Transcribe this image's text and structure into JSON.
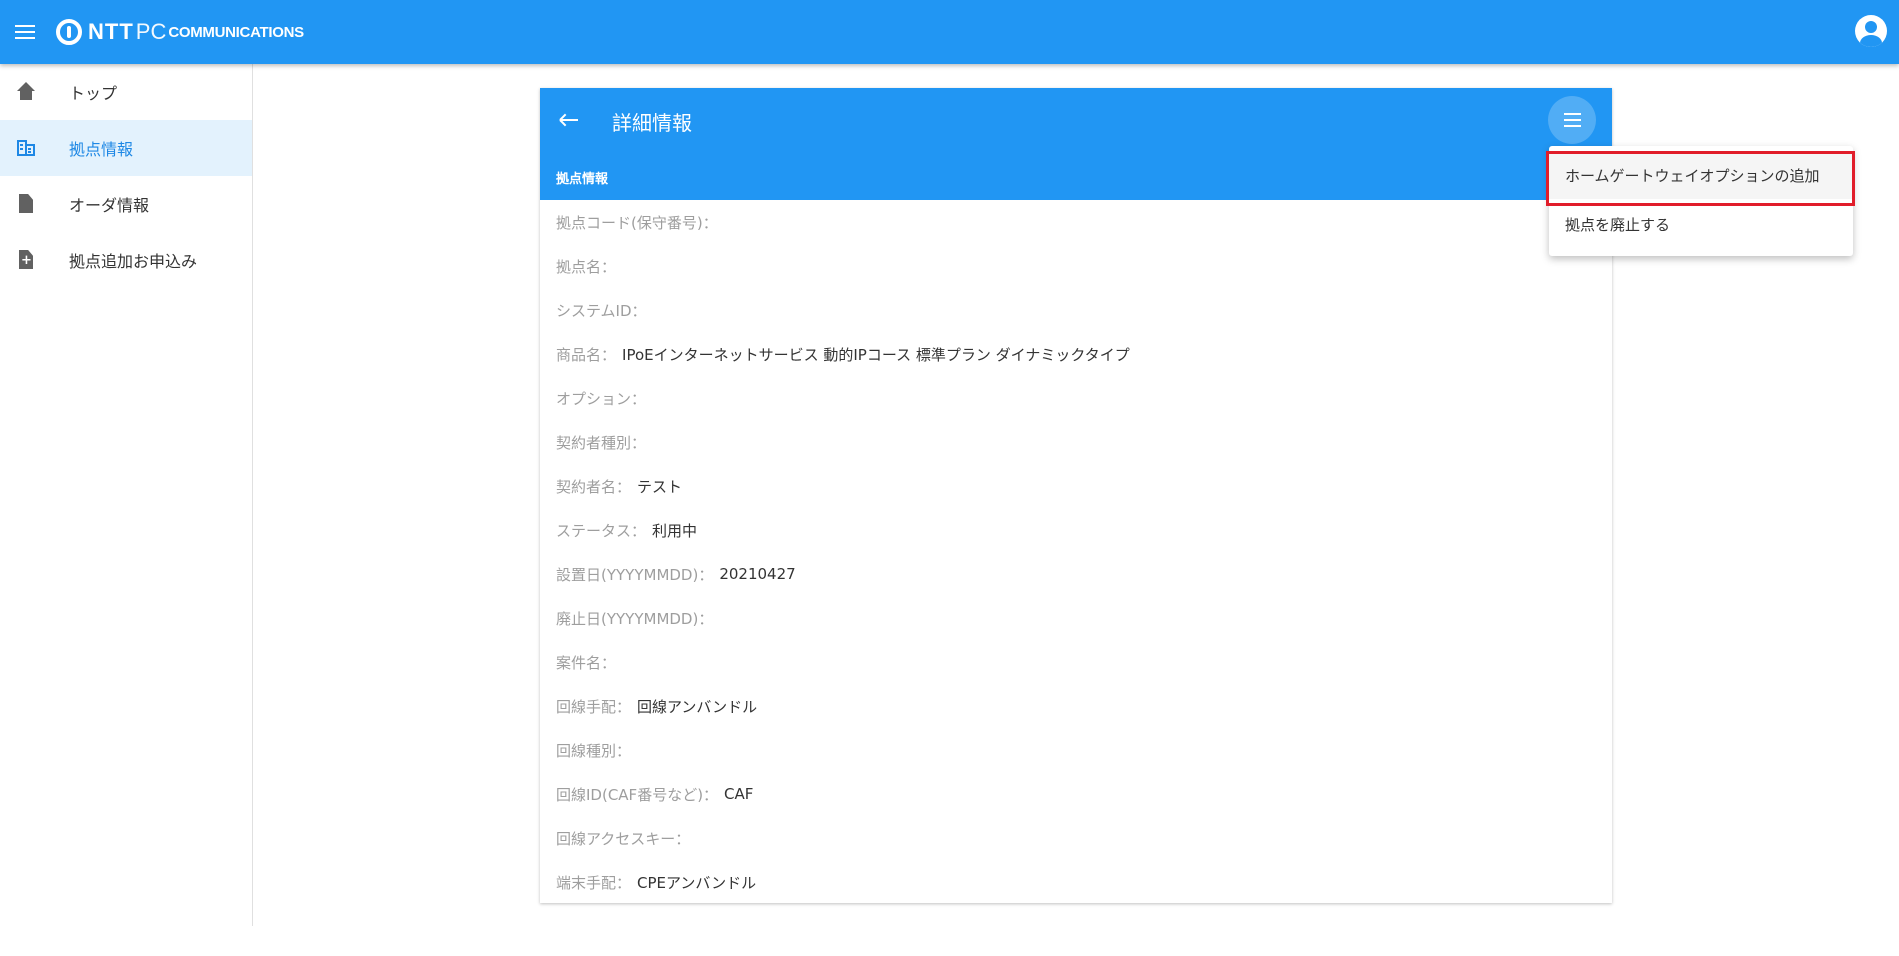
{
  "header": {
    "logo": {
      "ntt": "NTT",
      "pc": "PC",
      "communications": "COMMUNICATIONS"
    },
    "menu_icon": "hamburger-icon",
    "account_icon": "account-circle-icon",
    "brand_color": "#2196f3"
  },
  "sidebar": {
    "items": [
      {
        "label": "トップ",
        "icon": "home-icon",
        "active": false
      },
      {
        "label": "拠点情報",
        "icon": "building-icon",
        "active": true
      },
      {
        "label": "オーダ情報",
        "icon": "document-icon",
        "active": false
      },
      {
        "label": "拠点追加お申込み",
        "icon": "document-add-icon",
        "active": false
      }
    ]
  },
  "card": {
    "title": "詳細情報",
    "section_title": "拠点情報",
    "fields": [
      {
        "label": "拠点コード(保守番号)：",
        "value": ""
      },
      {
        "label": "拠点名：",
        "value": ""
      },
      {
        "label": "システムID：",
        "value": ""
      },
      {
        "label": "商品名：",
        "value": "IPoEインターネットサービス 動的IPコース 標準プラン ダイナミックタイプ"
      },
      {
        "label": "オプション：",
        "value": ""
      },
      {
        "label": "契約者種別：",
        "value": ""
      },
      {
        "label": "契約者名：",
        "value": "テスト"
      },
      {
        "label": "ステータス：",
        "value": "利用中"
      },
      {
        "label": "設置日(YYYYMMDD)：",
        "value": "20210427"
      },
      {
        "label": "廃止日(YYYYMMDD)：",
        "value": ""
      },
      {
        "label": "案件名：",
        "value": ""
      },
      {
        "label": "回線手配：",
        "value": "回線アンバンドル"
      },
      {
        "label": "回線種別：",
        "value": ""
      },
      {
        "label": "回線ID(CAF番号など)：",
        "value": "CAF"
      },
      {
        "label": "回線アクセスキー：",
        "value": ""
      },
      {
        "label": "端末手配：",
        "value": "CPEアンバンドル"
      }
    ]
  },
  "dropdown": {
    "items": [
      {
        "label": "ホームゲートウェイオプションの追加",
        "highlighted": true
      },
      {
        "label": "拠点を廃止する",
        "highlighted": false
      }
    ],
    "highlight_color": "#e11d2a"
  }
}
